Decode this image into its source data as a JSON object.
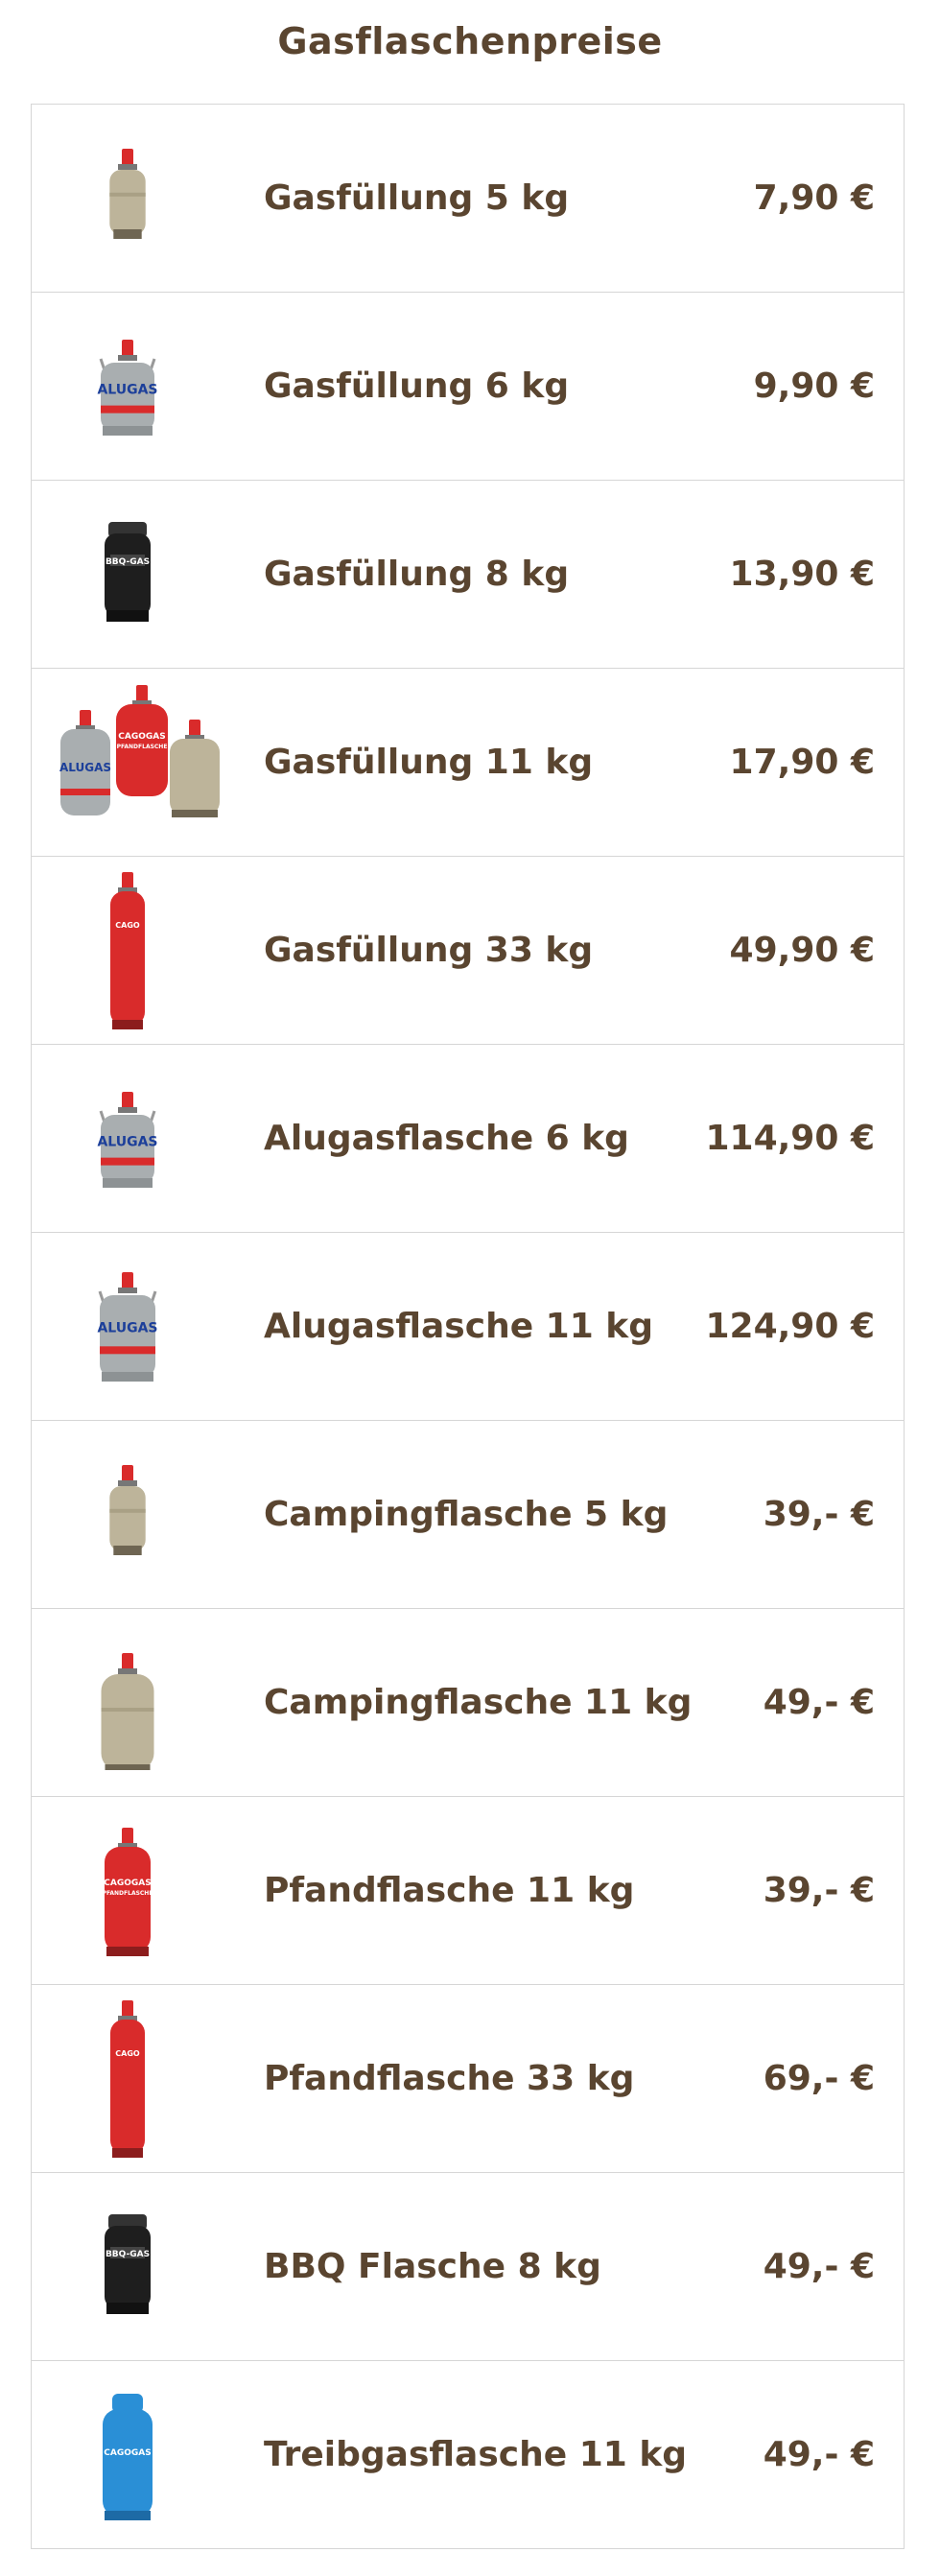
{
  "title": "Gasflaschenpreise",
  "rows": [
    {
      "name": "Gasfüllung 5 kg",
      "price": "7,90 €",
      "icon": "beige-gas-bottle-small-icon"
    },
    {
      "name": "Gasfüllung 6 kg",
      "price": "9,90 €",
      "icon": "alugas-bottle-icon"
    },
    {
      "name": "Gasfüllung 8 kg",
      "price": "13,90 €",
      "icon": "black-bbq-gas-bottle-icon"
    },
    {
      "name": "Gasfüllung 11 kg",
      "price": "17,90 €",
      "icon": "three-gas-bottles-icon"
    },
    {
      "name": "Gasfüllung 33 kg",
      "price": "49,90 €",
      "icon": "tall-red-gas-bottle-icon"
    },
    {
      "name": "Alugasflasche 6 kg",
      "price": "114,90 €",
      "icon": "alugas-bottle-icon"
    },
    {
      "name": "Alugasflasche 11 kg",
      "price": "124,90 €",
      "icon": "alugas-bottle-large-icon"
    },
    {
      "name": "Campingflasche 5 kg",
      "price": "39,- €",
      "icon": "beige-gas-bottle-small-icon"
    },
    {
      "name": "Campingflasche 11 kg",
      "price": "49,- €",
      "icon": "beige-gas-bottle-icon"
    },
    {
      "name": "Pfandflasche 11 kg",
      "price": "39,- €",
      "icon": "red-cagogas-bottle-icon"
    },
    {
      "name": "Pfandflasche 33 kg",
      "price": "69,- €",
      "icon": "tall-red-gas-bottle-icon"
    },
    {
      "name": "BBQ Flasche 8 kg",
      "price": "49,- €",
      "icon": "black-bbq-gas-bottle-icon"
    },
    {
      "name": "Treibgasflasche 11 kg",
      "price": "49,- €",
      "icon": "blue-cagogas-bottle-icon"
    }
  ],
  "logos": {
    "alugas": "ALUGAS",
    "bbq": "BBQ-GAS",
    "cagogas": "CAGOGAS",
    "pfand": "PFANDFLASCHE",
    "cago": "CAGO"
  },
  "colors": {
    "text": "#5a4530",
    "border": "#d6d6d6",
    "red": "#d92b2b",
    "beige": "#bdb49a",
    "silver": "#a9aeb0",
    "black": "#1e1e1e",
    "blue": "#2a8fd6"
  }
}
